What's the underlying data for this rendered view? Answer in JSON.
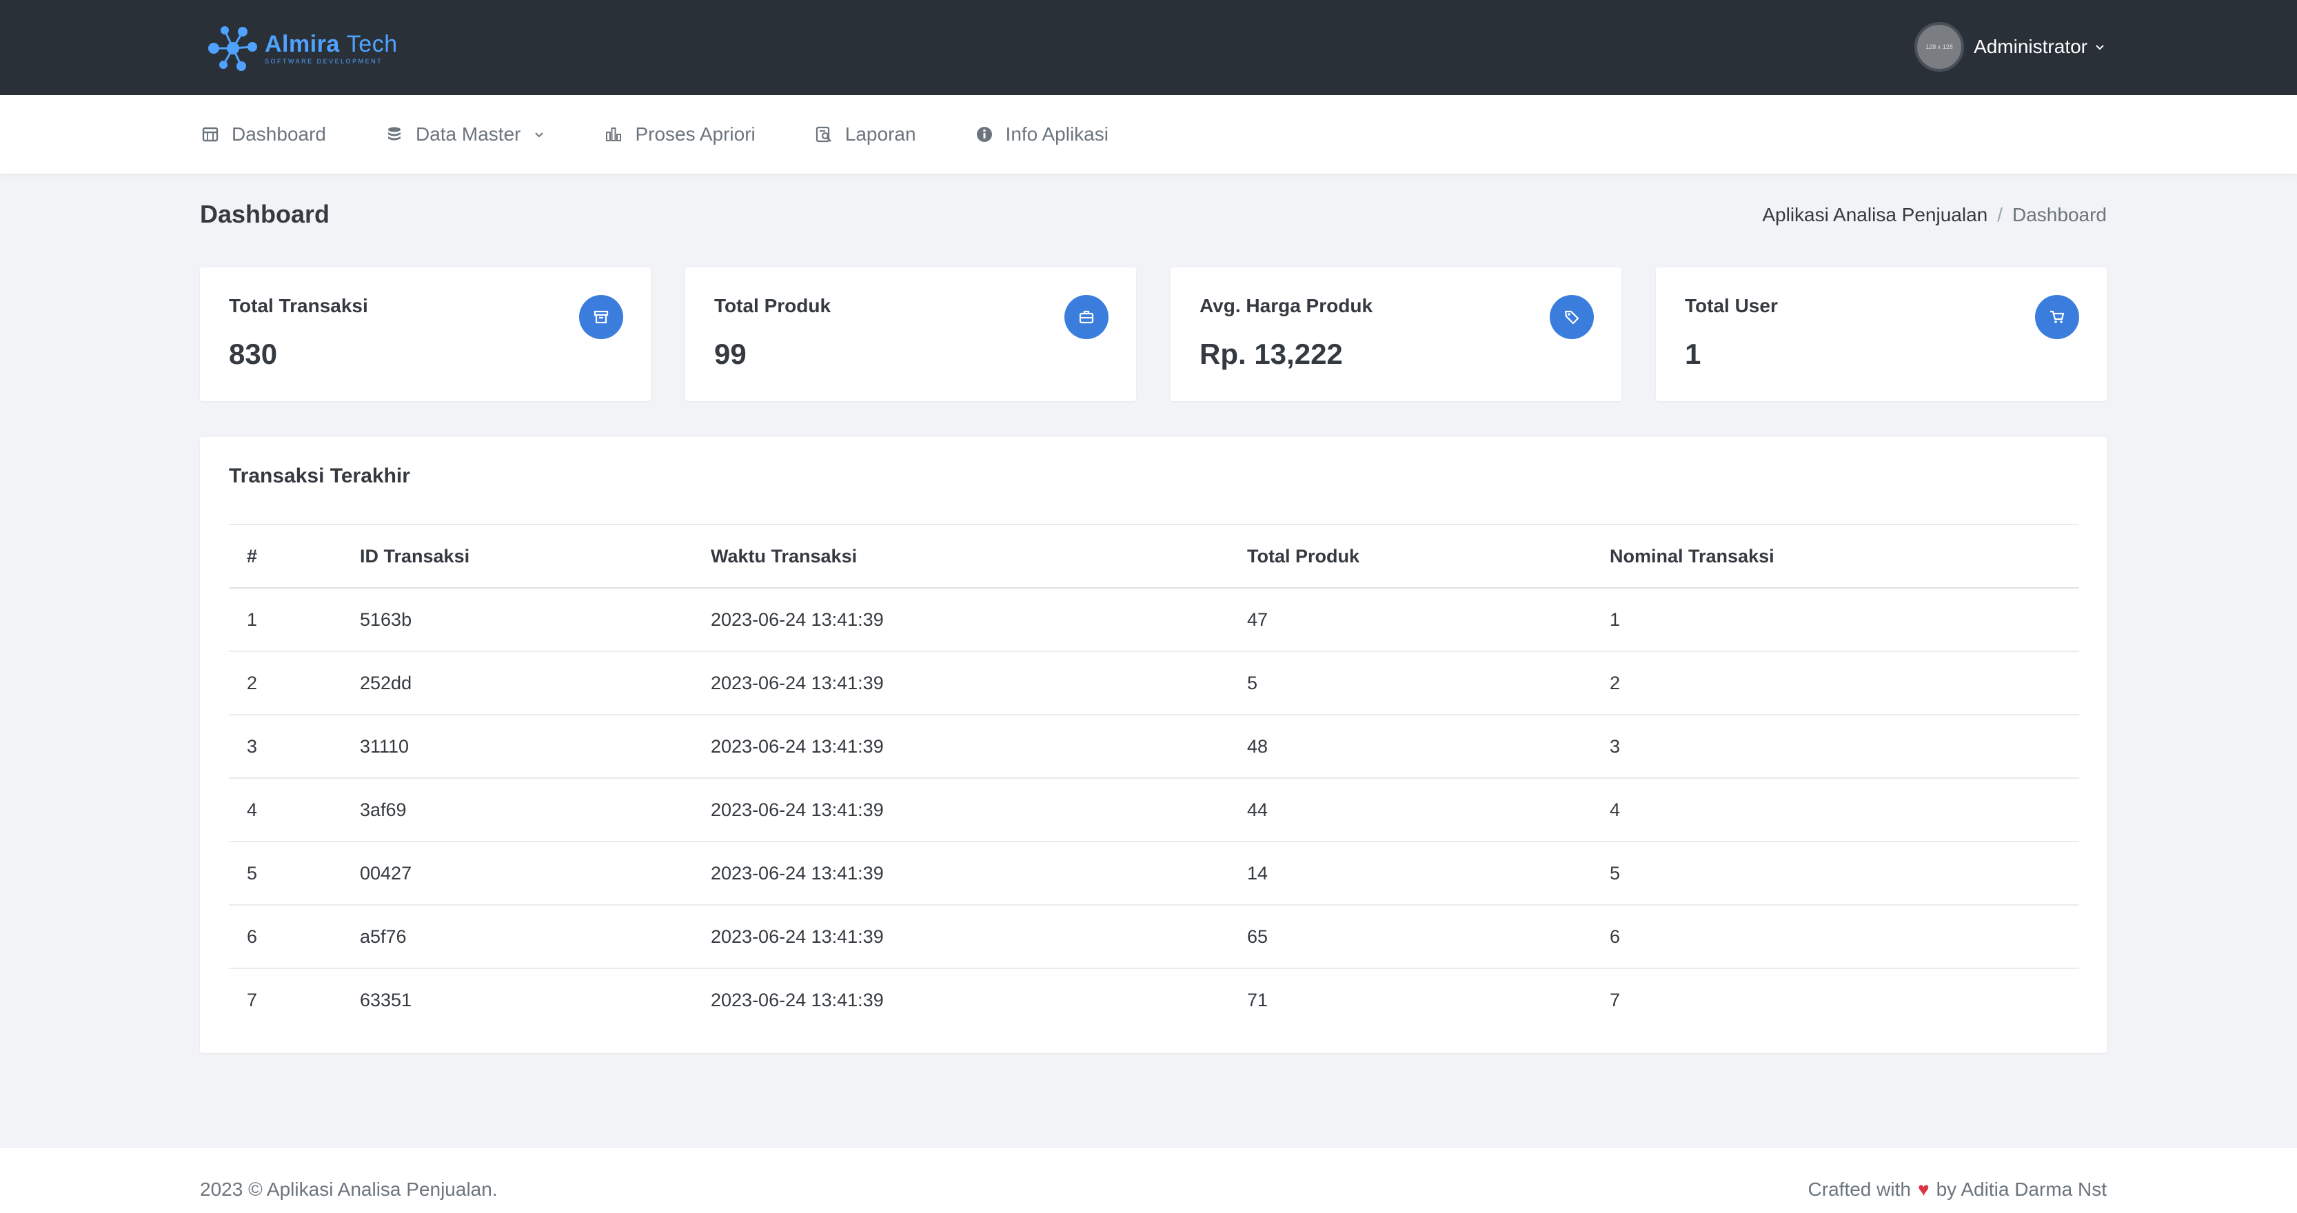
{
  "header": {
    "logo_name": "Almira",
    "logo_name_2": "Tech",
    "logo_sub": "SOFTWARE DEVELOPMENT",
    "avatar_text": "128 x 128",
    "user_name": "Administrator"
  },
  "nav": {
    "items": [
      {
        "label": "Dashboard",
        "icon": "calendar-icon"
      },
      {
        "label": "Data Master",
        "icon": "database-icon"
      },
      {
        "label": "Proses Apriori",
        "icon": "bar-chart-icon"
      },
      {
        "label": "Laporan",
        "icon": "report-search-icon"
      },
      {
        "label": "Info Aplikasi",
        "icon": "info-icon"
      }
    ]
  },
  "page": {
    "title": "Dashboard",
    "breadcrumb": [
      "Aplikasi Analisa Penjualan",
      "/",
      "Dashboard"
    ]
  },
  "cards": [
    {
      "label": "Total Transaksi",
      "value": "830",
      "icon": "archive-icon"
    },
    {
      "label": "Total Produk",
      "value": "99",
      "icon": "briefcase-icon"
    },
    {
      "label": "Avg. Harga Produk",
      "value": "Rp. 13,222",
      "icon": "tag-icon"
    },
    {
      "label": "Total User",
      "value": "1",
      "icon": "cart-icon"
    }
  ],
  "table": {
    "title": "Transaksi Terakhir",
    "headers": [
      "#",
      "ID Transaksi",
      "Waktu Transaksi",
      "Total Produk",
      "Nominal Transaksi"
    ],
    "rows": [
      [
        "1",
        "5163b",
        "2023-06-24 13:41:39",
        "47",
        "1"
      ],
      [
        "2",
        "252dd",
        "2023-06-24 13:41:39",
        "5",
        "2"
      ],
      [
        "3",
        "31110",
        "2023-06-24 13:41:39",
        "48",
        "3"
      ],
      [
        "4",
        "3af69",
        "2023-06-24 13:41:39",
        "44",
        "4"
      ],
      [
        "5",
        "00427",
        "2023-06-24 13:41:39",
        "14",
        "5"
      ],
      [
        "6",
        "a5f76",
        "2023-06-24 13:41:39",
        "65",
        "6"
      ],
      [
        "7",
        "63351",
        "2023-06-24 13:41:39",
        "71",
        "7"
      ]
    ]
  },
  "footer": {
    "left": "2023 © Aplikasi Analisa Penjualan.",
    "right_pre": "Crafted with",
    "heart": "♥",
    "right_post": "by Aditia Darma Nst"
  },
  "colors": {
    "header_bg": "#2a3038",
    "accent": "#3b7ddd",
    "logo": "#4fa3ff",
    "heart": "#dc3545"
  }
}
